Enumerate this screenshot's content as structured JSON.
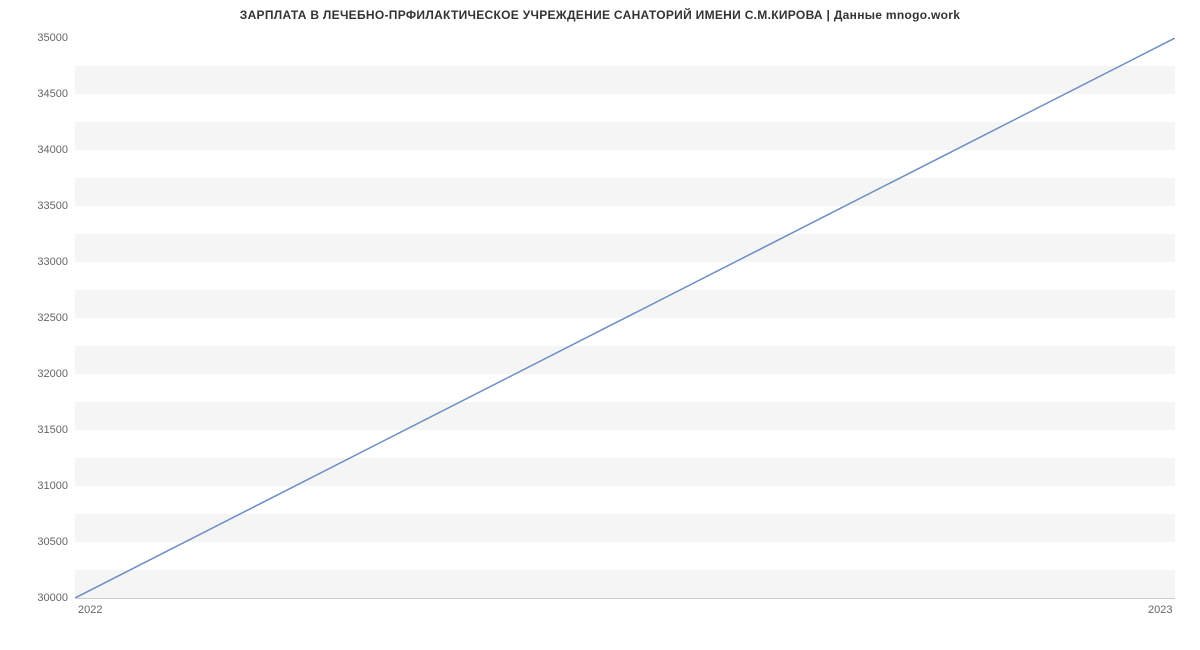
{
  "chart_data": {
    "type": "line",
    "title": "ЗАРПЛАТА В ЛЕЧЕБНО-ПРФИЛАКТИЧЕСКОЕ УЧРЕЖДЕНИЕ САНАТОРИЙ ИМЕНИ С.М.КИРОВА | Данные mnogo.work",
    "x": [
      "2022",
      "2023"
    ],
    "values": [
      30000,
      35000
    ],
    "xlabel": "",
    "ylabel": "",
    "ylim": [
      30000,
      35000
    ],
    "y_ticks": [
      30000,
      30500,
      31000,
      31500,
      32000,
      32500,
      33000,
      33500,
      34000,
      34500,
      35000
    ],
    "x_ticks": [
      "2022",
      "2023"
    ],
    "line_color": "#6c8ec4"
  }
}
